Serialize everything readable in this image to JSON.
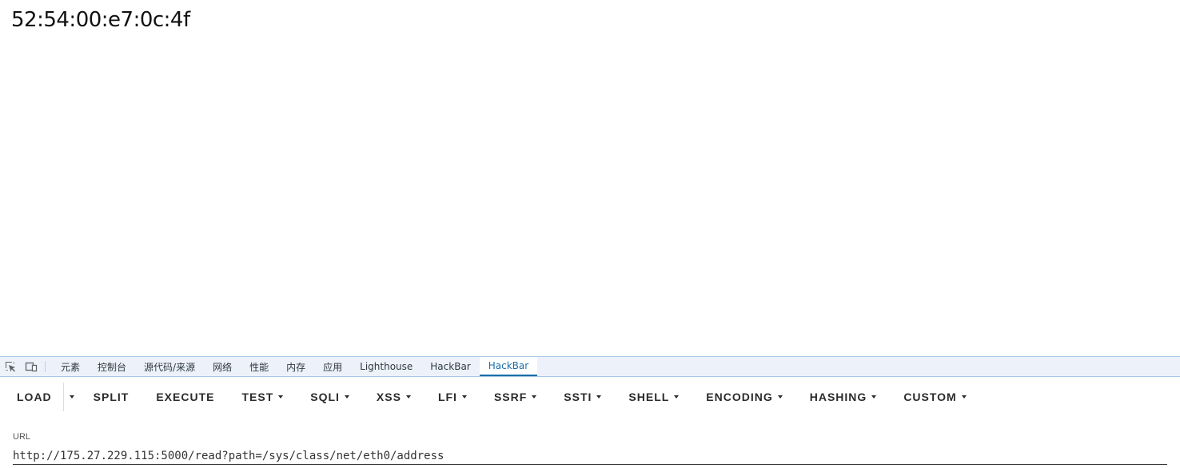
{
  "page": {
    "content_text": "52:54:00:e7:0c:4f"
  },
  "devtools": {
    "tabs": [
      {
        "label": "元素",
        "name": "tab-elements"
      },
      {
        "label": "控制台",
        "name": "tab-console"
      },
      {
        "label": "源代码/来源",
        "name": "tab-sources"
      },
      {
        "label": "网络",
        "name": "tab-network"
      },
      {
        "label": "性能",
        "name": "tab-performance"
      },
      {
        "label": "内存",
        "name": "tab-memory"
      },
      {
        "label": "应用",
        "name": "tab-application"
      },
      {
        "label": "Lighthouse",
        "name": "tab-lighthouse"
      },
      {
        "label": "HackBar",
        "name": "tab-hackbar-1"
      },
      {
        "label": "HackBar",
        "name": "tab-hackbar-2"
      }
    ],
    "active_tab_index": 9,
    "accent_color": "#1a6fa8"
  },
  "hackbar": {
    "load": "LOAD",
    "buttons": [
      {
        "label": "SPLIT",
        "dropdown": false
      },
      {
        "label": "EXECUTE",
        "dropdown": false
      },
      {
        "label": "TEST",
        "dropdown": true
      },
      {
        "label": "SQLI",
        "dropdown": true
      },
      {
        "label": "XSS",
        "dropdown": true
      },
      {
        "label": "LFI",
        "dropdown": true
      },
      {
        "label": "SSRF",
        "dropdown": true
      },
      {
        "label": "SSTI",
        "dropdown": true
      },
      {
        "label": "SHELL",
        "dropdown": true
      },
      {
        "label": "ENCODING",
        "dropdown": true
      },
      {
        "label": "HASHING",
        "dropdown": true
      },
      {
        "label": "CUSTOM",
        "dropdown": true
      }
    ],
    "url_label": "URL",
    "url_value": "http://175.27.229.115:5000/read?path=/sys/class/net/eth0/address"
  }
}
